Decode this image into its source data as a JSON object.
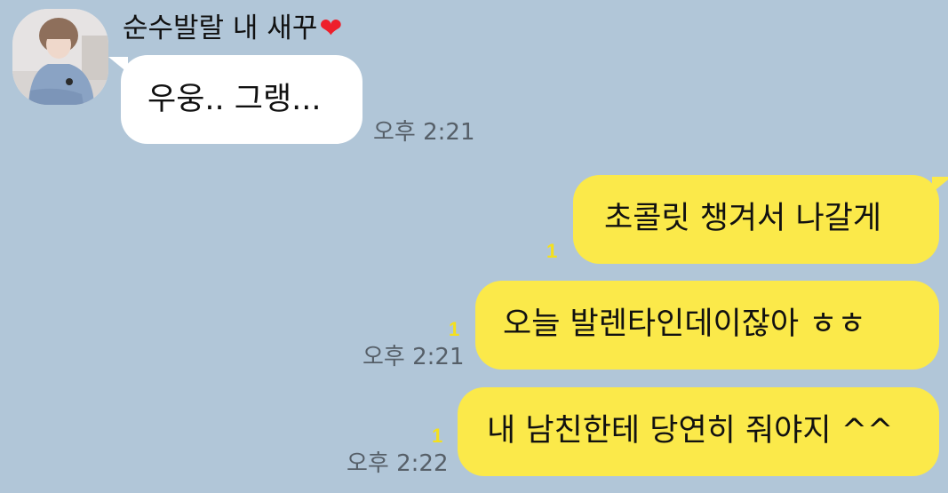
{
  "sender": {
    "name": "순수발랄 내 새꾸",
    "name_emoji": "❤"
  },
  "messages": [
    {
      "direction": "incoming",
      "text": "우웅.. 그랭...",
      "time": "오후 2:21"
    },
    {
      "direction": "outgoing",
      "text": "초콜릿 챙겨서 나갈게",
      "unread": "1"
    },
    {
      "direction": "outgoing",
      "text": "오늘 발렌타인데이잖아 ㅎㅎ",
      "unread": "1",
      "time": "오후 2:21"
    },
    {
      "direction": "outgoing",
      "text": "내 남친한테 당연히 줘야지 ^^",
      "unread": "1",
      "time": "오후 2:22"
    }
  ],
  "colors": {
    "background": "#b1c6d8",
    "incoming_bubble": "#ffffff",
    "outgoing_bubble": "#fbe94a",
    "unread_count": "#f4e01d"
  }
}
